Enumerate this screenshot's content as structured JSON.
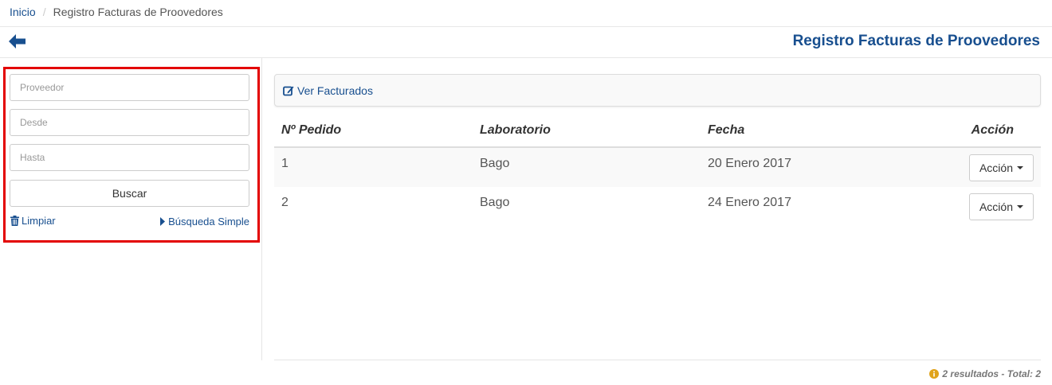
{
  "breadcrumb": {
    "home": "Inicio",
    "separator": "/",
    "current": "Registro Facturas de Proovedores"
  },
  "header": {
    "back_icon": "arrow-left-icon",
    "title": "Registro Facturas de Proovedores"
  },
  "filters": {
    "proveedor_placeholder": "Proveedor",
    "desde_placeholder": "Desde",
    "hasta_placeholder": "Hasta",
    "buscar_label": "Buscar",
    "limpiar_label": "Limpiar",
    "busqueda_simple_label": "Búsqueda Simple",
    "highlight_color": "#e30000"
  },
  "panel": {
    "ver_facturados_label": "Ver Facturados"
  },
  "table": {
    "headers": [
      "Nº Pedido",
      "Laboratorio",
      "Fecha",
      "Acción"
    ],
    "rows": [
      {
        "pedido": "1",
        "laboratorio": "Bago",
        "fecha": "20 Enero 2017",
        "accion": "Acción"
      },
      {
        "pedido": "2",
        "laboratorio": "Bago",
        "fecha": "24 Enero 2017",
        "accion": "Acción"
      }
    ]
  },
  "footer": {
    "results_text": "2 resultados - Total: 2"
  },
  "colors": {
    "link": "#184f8f",
    "info_icon": "#e0a31a"
  }
}
